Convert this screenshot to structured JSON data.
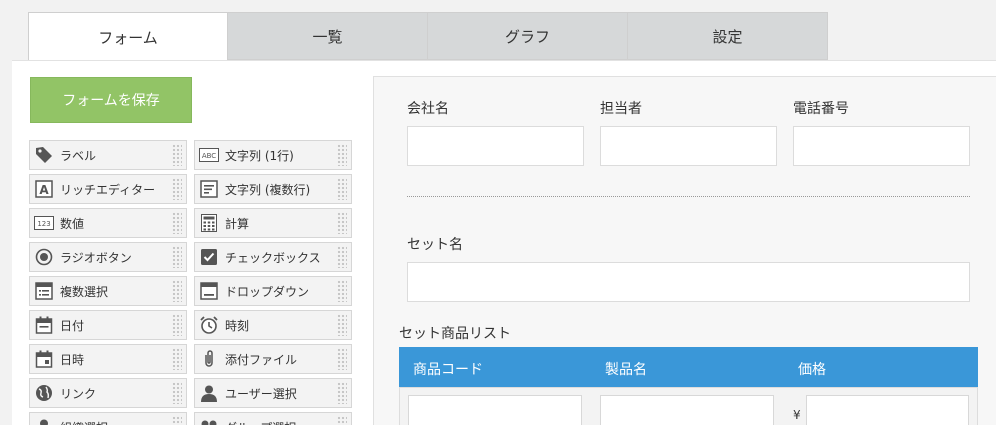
{
  "tabs": [
    {
      "label": "フォーム",
      "active": true
    },
    {
      "label": "一覧",
      "active": false
    },
    {
      "label": "グラフ",
      "active": false
    },
    {
      "label": "設定",
      "active": false
    }
  ],
  "save_button": "フォームを保存",
  "palette": [
    {
      "label": "ラベル",
      "icon": "tag-icon"
    },
    {
      "label": "文字列 (1行)",
      "icon": "abc-text-icon"
    },
    {
      "label": "リッチエディター",
      "icon": "rich-editor-icon"
    },
    {
      "label": "文字列 (複数行)",
      "icon": "multiline-text-icon"
    },
    {
      "label": "数値",
      "icon": "number-123-icon"
    },
    {
      "label": "計算",
      "icon": "calculator-icon"
    },
    {
      "label": "ラジオボタン",
      "icon": "radio-button-icon"
    },
    {
      "label": "チェックボックス",
      "icon": "checkbox-icon"
    },
    {
      "label": "複数選択",
      "icon": "multi-select-icon"
    },
    {
      "label": "ドロップダウン",
      "icon": "dropdown-icon"
    },
    {
      "label": "日付",
      "icon": "calendar-icon"
    },
    {
      "label": "時刻",
      "icon": "alarm-clock-icon"
    },
    {
      "label": "日時",
      "icon": "calendar-date-icon"
    },
    {
      "label": "添付ファイル",
      "icon": "paperclip-icon"
    },
    {
      "label": "リンク",
      "icon": "globe-icon"
    },
    {
      "label": "ユーザー選択",
      "icon": "user-icon"
    },
    {
      "label": "組織選択",
      "icon": "organization-icon"
    },
    {
      "label": "グループ選択",
      "icon": "group-icon"
    }
  ],
  "form": {
    "company_label": "会社名",
    "person_label": "担当者",
    "phone_label": "電話番号",
    "set_name_label": "セット名",
    "set_list_label": "セット商品リスト",
    "table_headers": [
      "商品コード",
      "製品名",
      "価格"
    ],
    "currency": "¥"
  }
}
